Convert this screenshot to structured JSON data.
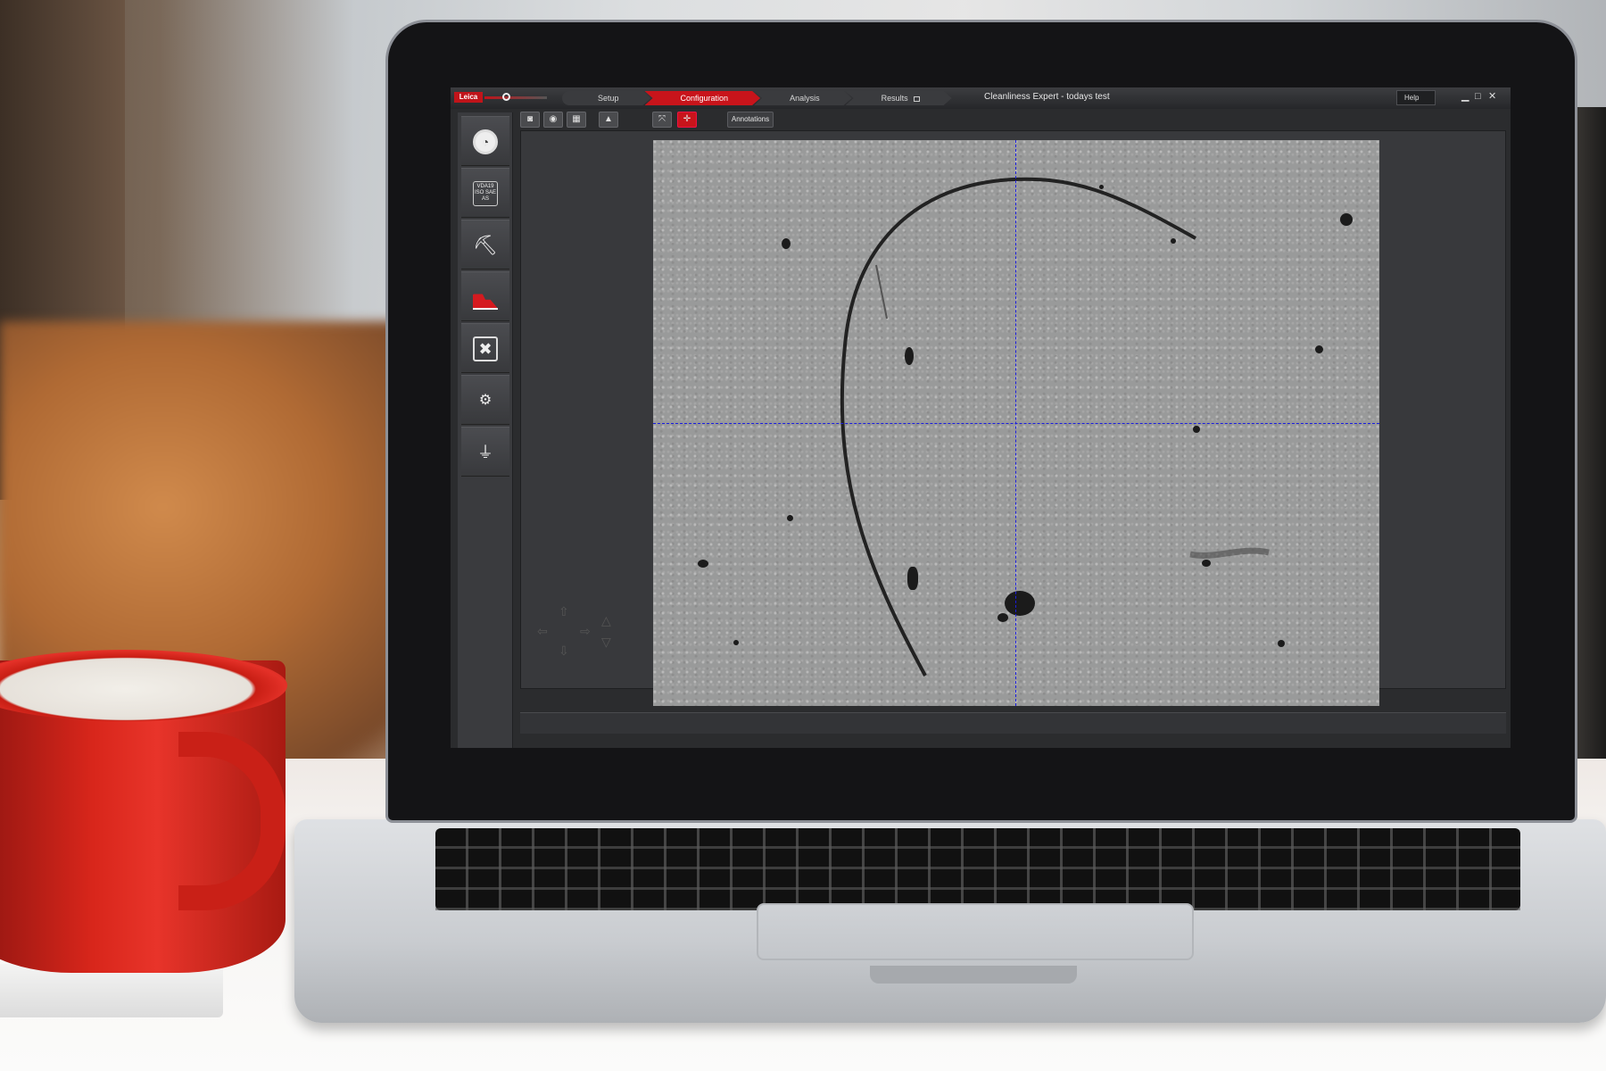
{
  "app": {
    "logo_text": "Leica",
    "window_title": "Cleanliness Expert - todays test",
    "help_label": "Help",
    "window_controls": [
      "▁",
      "□",
      "✕"
    ]
  },
  "workflow_tabs": [
    {
      "label": "Setup",
      "active": false
    },
    {
      "label": "Configuration",
      "active": true
    },
    {
      "label": "Analysis",
      "active": false
    },
    {
      "label": "Results",
      "active": false,
      "locked": true
    }
  ],
  "toolbar": {
    "buttons": [
      {
        "icon": "record-icon",
        "glyph": "◙"
      },
      {
        "icon": "camera-icon",
        "glyph": "◉"
      },
      {
        "icon": "grid-icon",
        "glyph": "▦"
      },
      {
        "icon": "histogram-icon",
        "glyph": "▲"
      },
      {
        "icon": "fit-to-screen-icon",
        "glyph": "⤧"
      },
      {
        "icon": "crosshair-icon",
        "glyph": "✛",
        "active": true
      }
    ],
    "annotations_label": "Annotations"
  },
  "sidebar": {
    "items": [
      {
        "icon": "gauge-icon",
        "glyph": "◔"
      },
      {
        "icon": "standards-icon",
        "text": "VDA19 ISO SAE AS"
      },
      {
        "icon": "microscope-icon",
        "glyph": "⛏"
      },
      {
        "icon": "particle-histogram-icon",
        "glyph": ""
      },
      {
        "icon": "tools-icon",
        "glyph": "✖"
      },
      {
        "icon": "lamp-settings-icon",
        "glyph": "⚙"
      },
      {
        "icon": "lamp-icon",
        "glyph": "⏚"
      }
    ]
  },
  "colors": {
    "accent": "#c8141b",
    "crosshair": "#1a1ce0",
    "panel": "#38393c"
  }
}
